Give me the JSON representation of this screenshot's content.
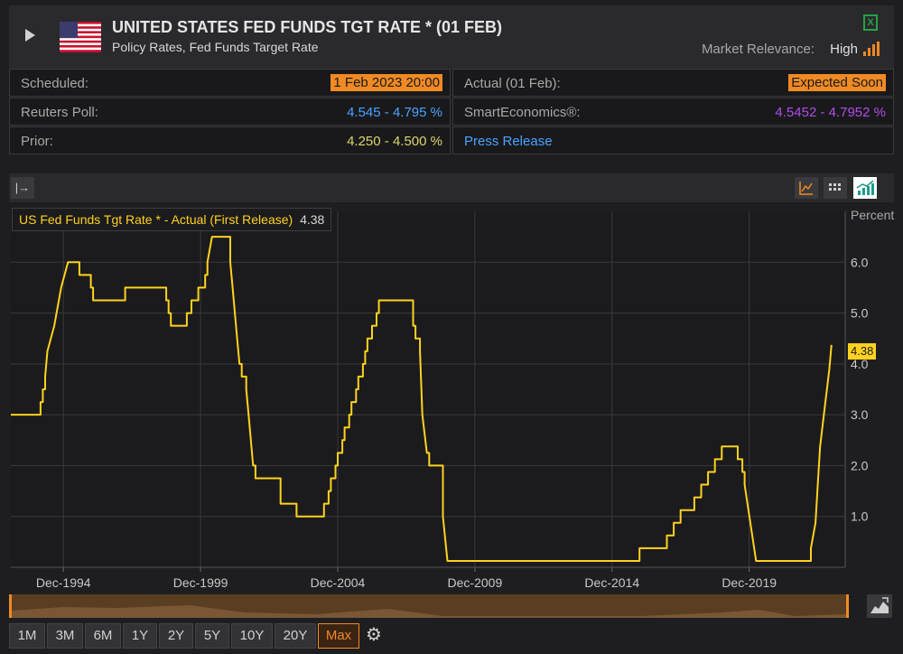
{
  "header": {
    "title": "UNITED STATES FED FUNDS TGT RATE * (01 FEB)",
    "subtitle": "Policy Rates, Fed Funds Target Rate",
    "relevance_label": "Market Relevance:",
    "relevance_value": "High",
    "excel_glyph": "X"
  },
  "info": {
    "scheduled": {
      "label": "Scheduled:",
      "value": "1 Feb 2023 20:00"
    },
    "actual": {
      "label": "Actual (01 Feb):",
      "value": "Expected Soon"
    },
    "poll": {
      "label": "Reuters Poll:",
      "value": "4.545 - 4.795 %"
    },
    "smart": {
      "label": "SmartEconomics®:",
      "value": "4.5452 - 4.7952 %"
    },
    "prior": {
      "label": "Prior:",
      "value": "4.250 - 4.500 %"
    },
    "press_release": "Press Release"
  },
  "colors": {
    "accent": "#f08a24",
    "series": "#ffd21f",
    "poll": "#4aa3ff",
    "smart": "#b04ce8",
    "prior": "#dcd66a",
    "link": "#4aa3ff",
    "background": "#1e1e20",
    "panel": "#2a2a2d"
  },
  "toolbar": {
    "collapse_glyph": "|→",
    "icons": [
      "analysis-icon",
      "table-icon",
      "line-chart-icon"
    ]
  },
  "chart_data": {
    "type": "line",
    "title": "",
    "ylabel": "Percent",
    "xlabel": "",
    "ylim": [
      0,
      7
    ],
    "yticks": [
      1.0,
      2.0,
      3.0,
      4.0,
      5.0,
      6.0
    ],
    "ytick_labels": [
      "1.0",
      "2.0",
      "3.0",
      "4.0",
      "5.0",
      "6.0"
    ],
    "xticks": [
      "1994-12",
      "1999-12",
      "2004-12",
      "2009-12",
      "2014-12",
      "2019-12"
    ],
    "xtick_labels": [
      "Dec-1994",
      "Dec-1999",
      "Dec-2004",
      "Dec-2009",
      "Dec-2014",
      "Dec-2019"
    ],
    "xlim": [
      "1993-01",
      "2023-06"
    ],
    "grid": true,
    "legend": "top-left",
    "series": [
      {
        "name": "US Fed Funds Tgt Rate * - Actual (First Release)",
        "last_value": "4.38",
        "points": [
          [
            "1993-01",
            3.0
          ],
          [
            "1994-02",
            3.25
          ],
          [
            "1994-03",
            3.5
          ],
          [
            "1994-04",
            3.75
          ],
          [
            "1994-05",
            4.25
          ],
          [
            "1994-08",
            4.75
          ],
          [
            "1994-11",
            5.5
          ],
          [
            "1995-02",
            6.0
          ],
          [
            "1995-07",
            5.75
          ],
          [
            "1995-12",
            5.5
          ],
          [
            "1996-01",
            5.25
          ],
          [
            "1997-03",
            5.5
          ],
          [
            "1998-09",
            5.25
          ],
          [
            "1998-10",
            5.0
          ],
          [
            "1998-11",
            4.75
          ],
          [
            "1999-06",
            5.0
          ],
          [
            "1999-08",
            5.25
          ],
          [
            "1999-11",
            5.5
          ],
          [
            "2000-02",
            5.75
          ],
          [
            "2000-03",
            6.0
          ],
          [
            "2000-05",
            6.5
          ],
          [
            "2001-01",
            6.0
          ],
          [
            "2001-02",
            5.5
          ],
          [
            "2001-03",
            5.0
          ],
          [
            "2001-04",
            4.5
          ],
          [
            "2001-05",
            4.0
          ],
          [
            "2001-06",
            3.75
          ],
          [
            "2001-08",
            3.5
          ],
          [
            "2001-09",
            3.0
          ],
          [
            "2001-10",
            2.5
          ],
          [
            "2001-11",
            2.0
          ],
          [
            "2001-12",
            1.75
          ],
          [
            "2002-11",
            1.25
          ],
          [
            "2003-06",
            1.0
          ],
          [
            "2004-06",
            1.25
          ],
          [
            "2004-08",
            1.5
          ],
          [
            "2004-09",
            1.75
          ],
          [
            "2004-11",
            2.0
          ],
          [
            "2004-12",
            2.25
          ],
          [
            "2005-02",
            2.5
          ],
          [
            "2005-03",
            2.75
          ],
          [
            "2005-05",
            3.0
          ],
          [
            "2005-06",
            3.25
          ],
          [
            "2005-08",
            3.5
          ],
          [
            "2005-09",
            3.75
          ],
          [
            "2005-11",
            4.0
          ],
          [
            "2005-12",
            4.25
          ],
          [
            "2006-01",
            4.5
          ],
          [
            "2006-03",
            4.75
          ],
          [
            "2006-05",
            5.0
          ],
          [
            "2006-06",
            5.25
          ],
          [
            "2007-09",
            4.75
          ],
          [
            "2007-10",
            4.5
          ],
          [
            "2007-12",
            4.25
          ],
          [
            "2008-01",
            3.0
          ],
          [
            "2008-03",
            2.25
          ],
          [
            "2008-04",
            2.0
          ],
          [
            "2008-10",
            1.0
          ],
          [
            "2008-12",
            0.125
          ],
          [
            "2015-12",
            0.375
          ],
          [
            "2016-12",
            0.625
          ],
          [
            "2017-03",
            0.875
          ],
          [
            "2017-06",
            1.125
          ],
          [
            "2017-12",
            1.375
          ],
          [
            "2018-03",
            1.625
          ],
          [
            "2018-06",
            1.875
          ],
          [
            "2018-09",
            2.125
          ],
          [
            "2018-12",
            2.375
          ],
          [
            "2019-07",
            2.125
          ],
          [
            "2019-09",
            1.875
          ],
          [
            "2019-10",
            1.625
          ],
          [
            "2020-03",
            0.125
          ],
          [
            "2022-03",
            0.375
          ],
          [
            "2022-05",
            0.875
          ],
          [
            "2022-06",
            1.625
          ],
          [
            "2022-07",
            2.375
          ],
          [
            "2022-09",
            3.125
          ],
          [
            "2022-11",
            3.875
          ],
          [
            "2022-12",
            4.375
          ]
        ]
      }
    ]
  },
  "range_buttons": [
    "1M",
    "3M",
    "6M",
    "1Y",
    "2Y",
    "5Y",
    "10Y",
    "20Y",
    "Max"
  ],
  "active_range": "Max",
  "settings_glyph": "⚙"
}
